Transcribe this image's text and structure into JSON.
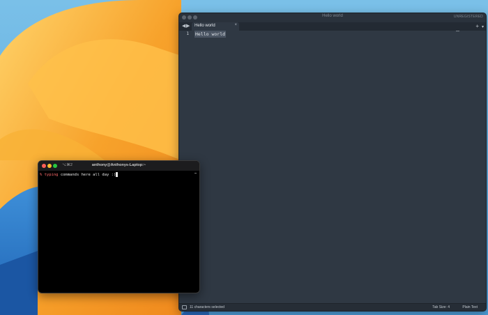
{
  "editor": {
    "window_title": "Hello world",
    "unregistered_label": "UNREGISTERED",
    "nav_back": "◀",
    "nav_forward": "▶",
    "tab": {
      "label": "Hello world",
      "close": "×"
    },
    "new_tab": "+",
    "tab_menu": "▾",
    "line_number": "1",
    "code_line_1": "Hello world",
    "status": {
      "selection": "11 characters selected",
      "tab_size": "Tab Size: 4",
      "syntax": "Plain Text"
    }
  },
  "terminal": {
    "shortcut": "⌥⌘2",
    "title": "anthony@Anthonys-Laptop:~",
    "prompt_symbol": "%",
    "command": "typing",
    "args": "commands here all day :)"
  },
  "colors": {
    "editor_bg": "#2f3843",
    "terminal_bg": "#000000",
    "prompt_red": "#ff6b6b",
    "close_red": "#ff5f57",
    "minimize_yellow": "#febc2e",
    "maximize_green": "#28c840"
  }
}
